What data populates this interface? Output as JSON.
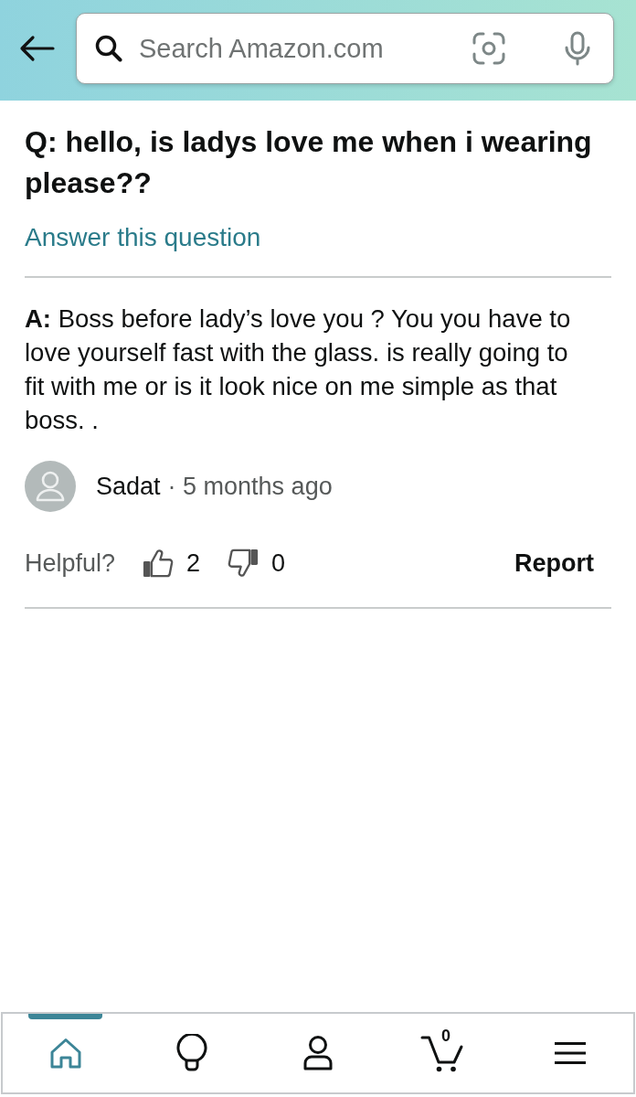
{
  "header": {
    "search": {
      "placeholder": "Search Amazon.com"
    }
  },
  "question": {
    "text": "Q: hello, is ladys love me when i wearing please??",
    "answer_link": "Answer this question"
  },
  "answer": {
    "text": "**A:** Boss before lady’s love you ? You you have to love yourself fast with the glass. is really going to fit with me or is it look nice on me simple as that boss. .",
    "author": "Sadat",
    "time": "· 5 months ago",
    "helpful_label": "Helpful?",
    "up_count": "2",
    "down_count": "0",
    "report": "Report"
  },
  "bottom_nav": {
    "items": [
      {
        "kind": "home",
        "selected": true
      },
      {
        "kind": "ideas",
        "selected": false
      },
      {
        "kind": "account",
        "selected": false
      },
      {
        "kind": "cart",
        "selected": false,
        "badge": "0"
      },
      {
        "kind": "menu",
        "selected": false
      }
    ]
  }
}
